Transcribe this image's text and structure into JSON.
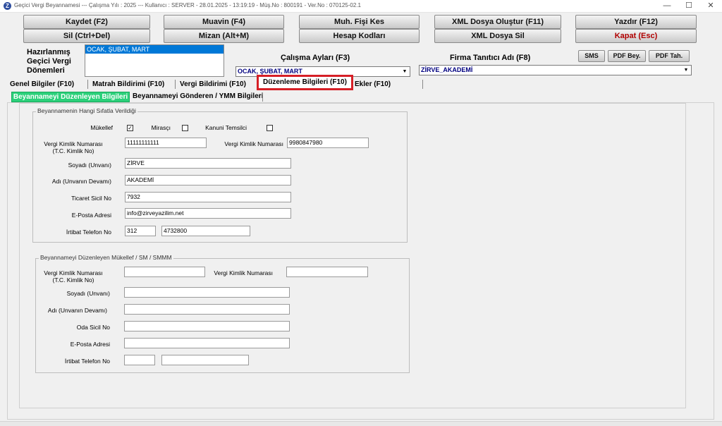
{
  "window": {
    "title": "Geçici Vergi Beyannamesi  ---  Çalışma Yılı : 2025  ---  Kullanıcı : SERVER - 28.01.2025 - 13:19:19 - Müş.No : 800191 - Ver.No : 070125-02.1",
    "icon_letter": "Z",
    "minimize": "—",
    "maximize": "☐",
    "close": "✕"
  },
  "toolbar": {
    "row1": [
      "Kaydet (F2)",
      "Muavin (F4)",
      "Muh. Fişi Kes",
      "XML Dosya Oluştur (F11)",
      "Yazdır (F12)"
    ],
    "row2": [
      "Sil (Ctrl+Del)",
      "Mizan (Alt+M)",
      "Hesap Kodları",
      "XML Dosya Sil",
      "Kapat (Esc)"
    ]
  },
  "periods": {
    "label_line1": "Hazırlanmış",
    "label_line2": "Geçici Vergi",
    "label_line3": "Dönemleri",
    "selected_item": "OCAK, ŞUBAT, MART"
  },
  "calisma_aylari": {
    "label": "Çalışma Ayları (F3)",
    "value": "OCAK, ŞUBAT, MART"
  },
  "firma": {
    "label": "Firma Tanıtıcı Adı (F8)",
    "value": "ZİRVE_AKADEMİ"
  },
  "small_buttons": [
    "SMS",
    "PDF Bey.",
    "PDF Tah."
  ],
  "tabs": [
    "Genel Bilgiler (F10)",
    "Matrah Bildirimi (F10)",
    "Vergi Bildirimi (F10)",
    "Düzenleme Bilgileri (F10)",
    "Ekler (F10)"
  ],
  "subtabs": [
    "Beyannameyi Düzenleyen Bilgileri",
    "Beyannameyi Gönderen / YMM Bilgileri"
  ],
  "group1": {
    "title": "Beyannamenin Hangi Sıfatla Verildiği",
    "checks": [
      {
        "label": "Mükellef",
        "checked": true,
        "mark": "✓"
      },
      {
        "label": "Mirasçı",
        "checked": false,
        "mark": ""
      },
      {
        "label": "Kanuni Temsilci",
        "checked": false,
        "mark": ""
      }
    ],
    "vkn_label": "Vergi Kimlik Numarası",
    "vkn_label2": "(T.C. Kimlik No)",
    "tckn_value": "11111111111",
    "vkn2_label": "Vergi Kimlik Numarası",
    "vkn2_value": "9980847980",
    "soyadi_label": "Soyadı (Unvanı)",
    "soyadi_value": "ZİRVE",
    "adi_label": "Adı (Unvanın Devamı)",
    "adi_value": "AKADEMİ",
    "ticaret_label": "Ticaret Sicil No",
    "ticaret_value": "7932",
    "eposta_label": "E-Posta Adresi",
    "eposta_value": "info@zirveyazilim.net",
    "telefon_label": "İrtibat Telefon No",
    "telefon_area": "312",
    "telefon_number": "4732800"
  },
  "group2": {
    "title": "Beyannameyi Düzenleyen Mükellef / SM / SMMM",
    "vkn_label": "Vergi Kimlik Numarası",
    "vkn_label2": "(T.C. Kimlik No)",
    "vkn2_label": "Vergi Kimlik Numarası",
    "soyadi_label": "Soyadı (Unvanı)",
    "adi_label": "Adı (Unvanın Devamı)",
    "oda_label": "Oda Sicil No",
    "eposta_label": "E-Posta Adresi",
    "telefon_label": "İrtibat Telefon No"
  },
  "colors": {
    "active_tab_border": "#d61f26",
    "active_subtab": "#2bd07a",
    "selection": "#0078d7",
    "combo_text": "#000080",
    "kapat_text": "#b00000"
  }
}
